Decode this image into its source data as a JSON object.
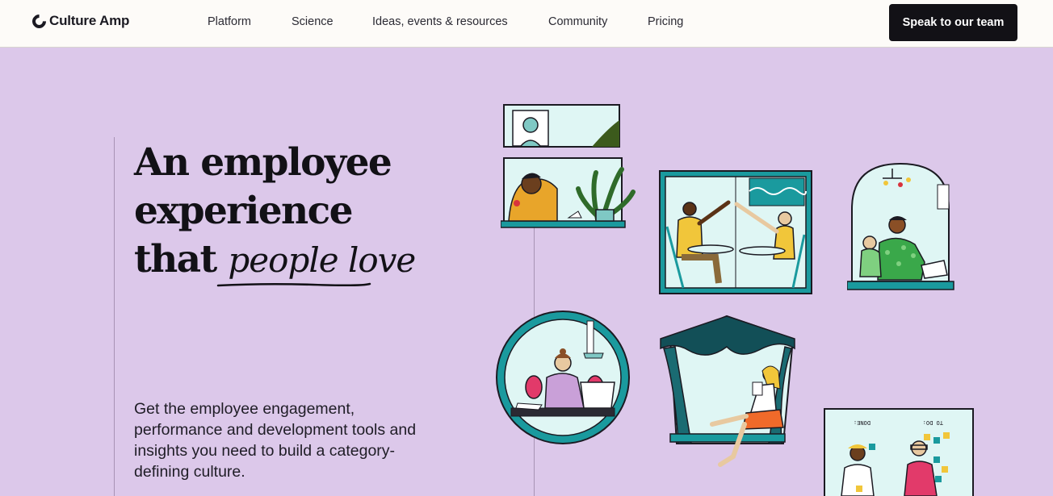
{
  "header": {
    "brand": "Culture Amp",
    "nav": [
      "Platform",
      "Science",
      "Ideas, events & resources",
      "Community",
      "Pricing"
    ],
    "cta_label": "Speak to our team"
  },
  "hero": {
    "headline_line1": "An employee",
    "headline_line2": "experience",
    "headline_line3_plain": "that",
    "headline_line3_script": "people love",
    "subcopy": "Get the employee engagement, performance and development tools and insights you need to build a category-defining culture."
  },
  "illustrations": {
    "todo_label": "TO DO:",
    "done_label": "DONE:"
  },
  "colors": {
    "background": "#dcc8ea",
    "header": "#fdfbf8",
    "cta": "#121116",
    "teal": "#1a9a9e",
    "panel_light": "#dff6f4"
  }
}
